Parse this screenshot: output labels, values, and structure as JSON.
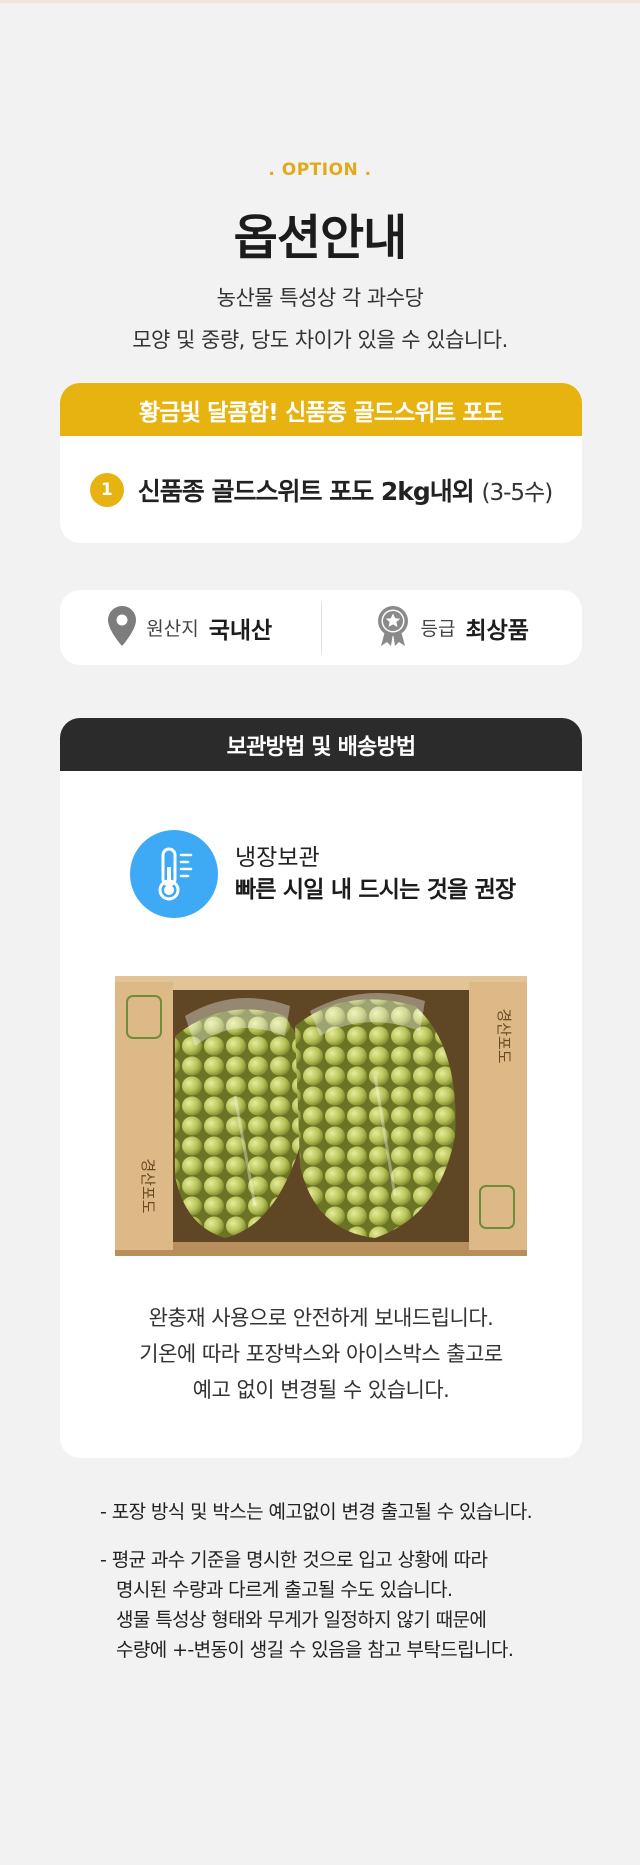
{
  "header": {
    "eyebrow": ". OPTION .",
    "title": "옵션안내",
    "subtitle_line1": "농산물 특성상 각 과수당",
    "subtitle_line2": "모양 및 중량, 당도 차이가 있을 수 있습니다."
  },
  "option_card": {
    "heading": "황금빛 달콤함! 신품종 골드스위트 포도",
    "items": [
      {
        "number": "1",
        "name": "신품종 골드스위트 포도 2kg내외",
        "note": "(3-5수)"
      }
    ]
  },
  "info": {
    "origin_label": "원산지",
    "origin_value": "국내산",
    "grade_label": "등급",
    "grade_value": "최상품",
    "origin_icon": "location-pin-icon",
    "grade_icon": "medal-icon"
  },
  "storage": {
    "heading": "보관방법 및 배송방법",
    "fridge_title": "냉장보관",
    "fridge_desc": "빠른 시일 내 드시는 것을 권장",
    "thermo_icon": "thermometer-icon",
    "box_text_top": "경산포도",
    "box_text_bottom": "경산포도",
    "packing_line1": "완충재 사용으로 안전하게 보내드립니다.",
    "packing_line2": "기온에 따라 포장박스와 아이스박스 출고로",
    "packing_line3": "예고 없이 변경될 수 있습니다."
  },
  "notes": {
    "note1": "- 포장 방식 및 박스는 예고없이 변경 출고될 수 있습니다.",
    "note2_line1": "- 평균 과수 기준을 명시한 것으로 입고 상황에 따라",
    "note2_line2": "명시된 수량과 다르게 출고될 수도 있습니다.",
    "note2_line3": "생물 특성상 형태와 무게가 일정하지 않기 때문에",
    "note2_line4": "수량에 +-변동이 생길 수 있음을 참고 부탁드립니다."
  },
  "colors": {
    "accent": "#e7b311",
    "dark": "#2b2b2b",
    "blue": "#3ea9f5",
    "background": "#f3f2f2"
  }
}
